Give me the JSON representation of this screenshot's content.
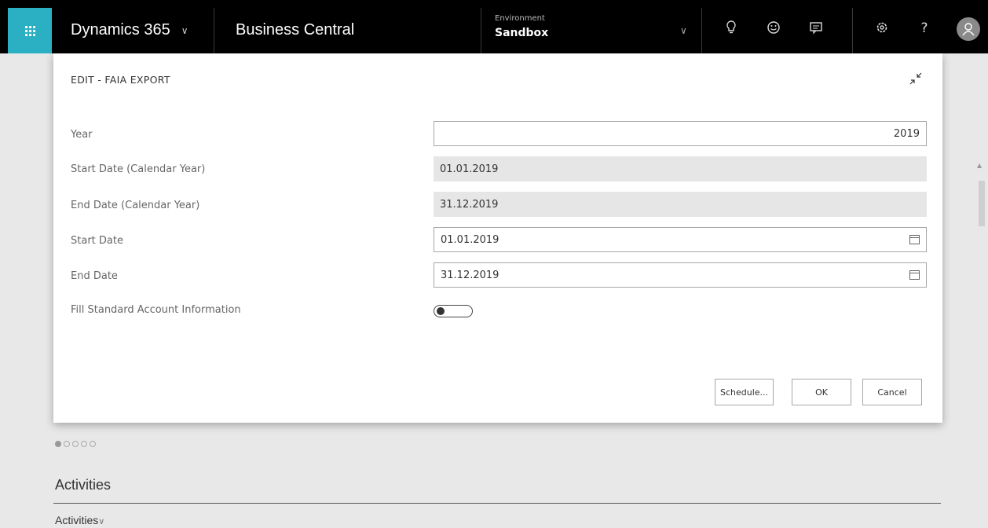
{
  "header": {
    "brand": "Dynamics 365",
    "app_name": "Business Central",
    "environment_label": "Environment",
    "environment_value": "Sandbox",
    "icons": [
      "waffle-icon",
      "lightbulb-icon",
      "smiley-icon",
      "feedback-icon",
      "settings-icon",
      "help-icon",
      "user-icon"
    ],
    "help_glyph": "?",
    "accent_color": "#2ab0c2"
  },
  "dialog": {
    "title": "EDIT - FAIA EXPORT",
    "fields": [
      {
        "label": "Year",
        "value": "2019",
        "type": "input"
      },
      {
        "label": "Start Date (Calendar Year)",
        "value": "01.01.2019",
        "type": "readonly"
      },
      {
        "label": "End Date (Calendar Year)",
        "value": "31.12.2019",
        "type": "readonly"
      },
      {
        "label": "Start Date",
        "value": "01.01.2019",
        "type": "date"
      },
      {
        "label": "End Date",
        "value": "31.12.2019",
        "type": "date"
      }
    ],
    "toggle": {
      "label": "Fill Standard Account Information",
      "checked": false
    },
    "buttons": {
      "schedule": "Schedule...",
      "ok": "OK",
      "cancel": "Cancel"
    }
  },
  "page": {
    "carousel": {
      "count": 5,
      "active": 1
    },
    "activities_title": "Activities",
    "activities_subtitle": "Activities"
  }
}
